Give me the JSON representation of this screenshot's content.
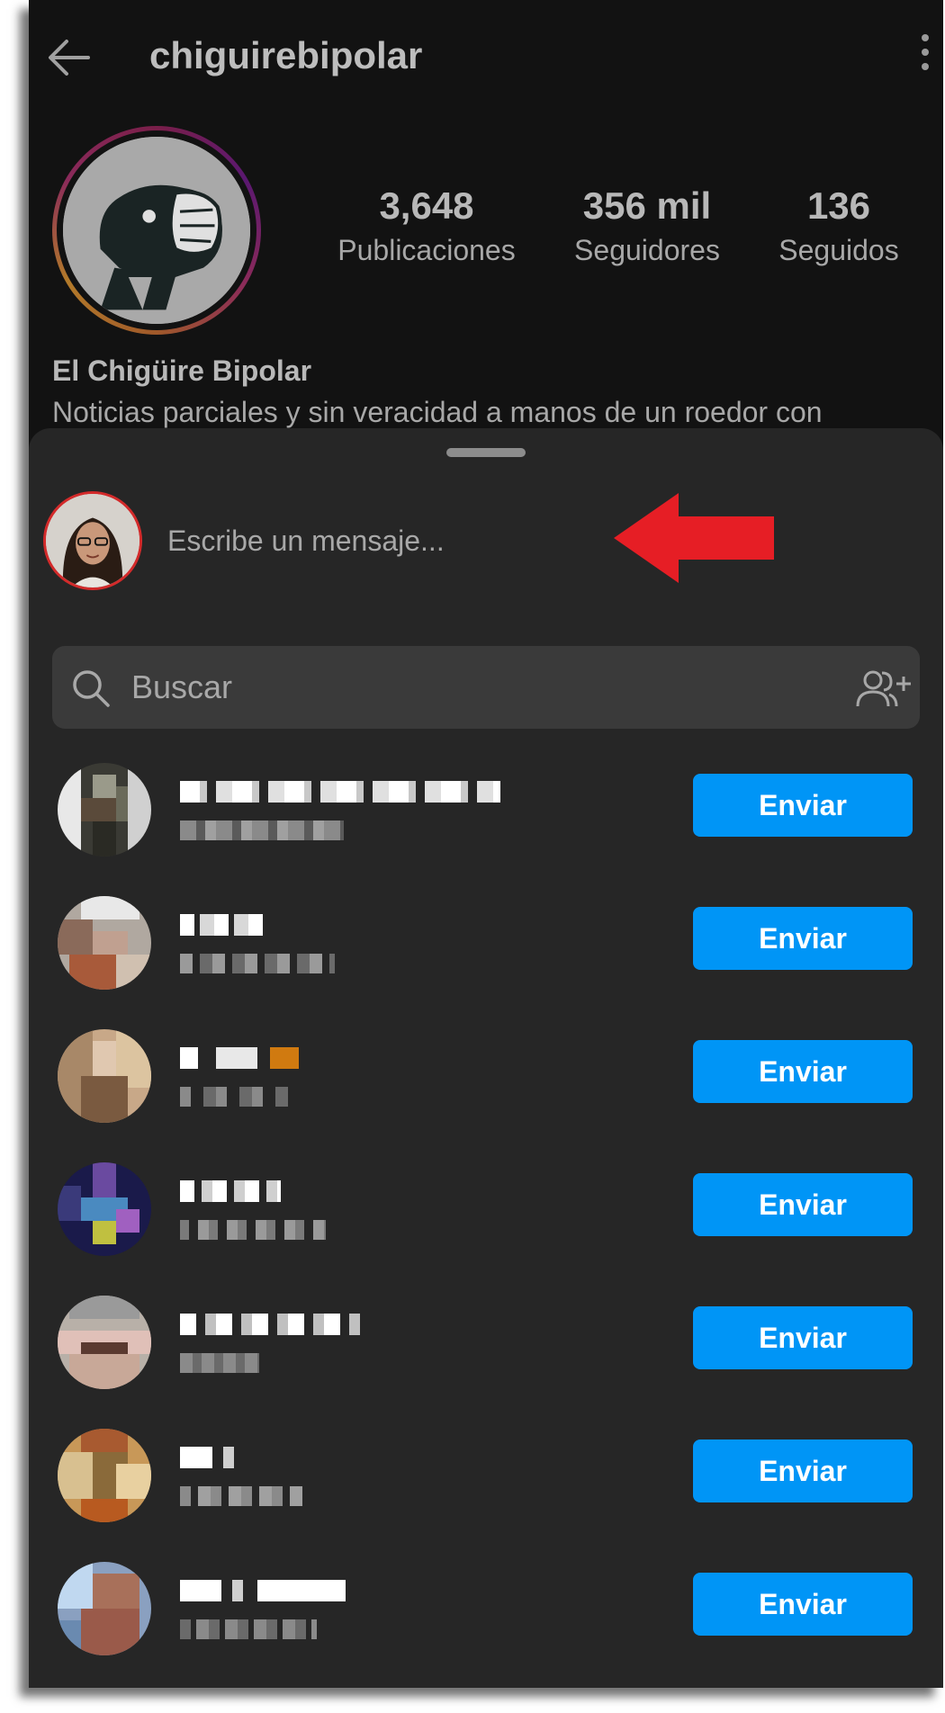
{
  "profile": {
    "username": "chiguirebipolar",
    "stats": [
      {
        "value": "3,648",
        "label": "Publicaciones"
      },
      {
        "value": "356 mil",
        "label": "Seguidores"
      },
      {
        "value": "136",
        "label": "Seguidos"
      }
    ],
    "display_name": "El Chigüire Bipolar",
    "bio": "Noticias parciales y sin veracidad a manos de un roedor con"
  },
  "share_sheet": {
    "message_placeholder": "Escribe un mensaje...",
    "search_placeholder": "Buscar",
    "send_label": "Enviar",
    "contact_count_note": "names pixelated",
    "colors": {
      "accent": "#0095f6",
      "sheet_bg": "#262626",
      "highlight_arrow": "#e61e25"
    }
  },
  "icons": [
    "back-arrow-icon",
    "more-vertical-icon",
    "search-icon",
    "add-group-icon",
    "red-arrow-annotation"
  ]
}
